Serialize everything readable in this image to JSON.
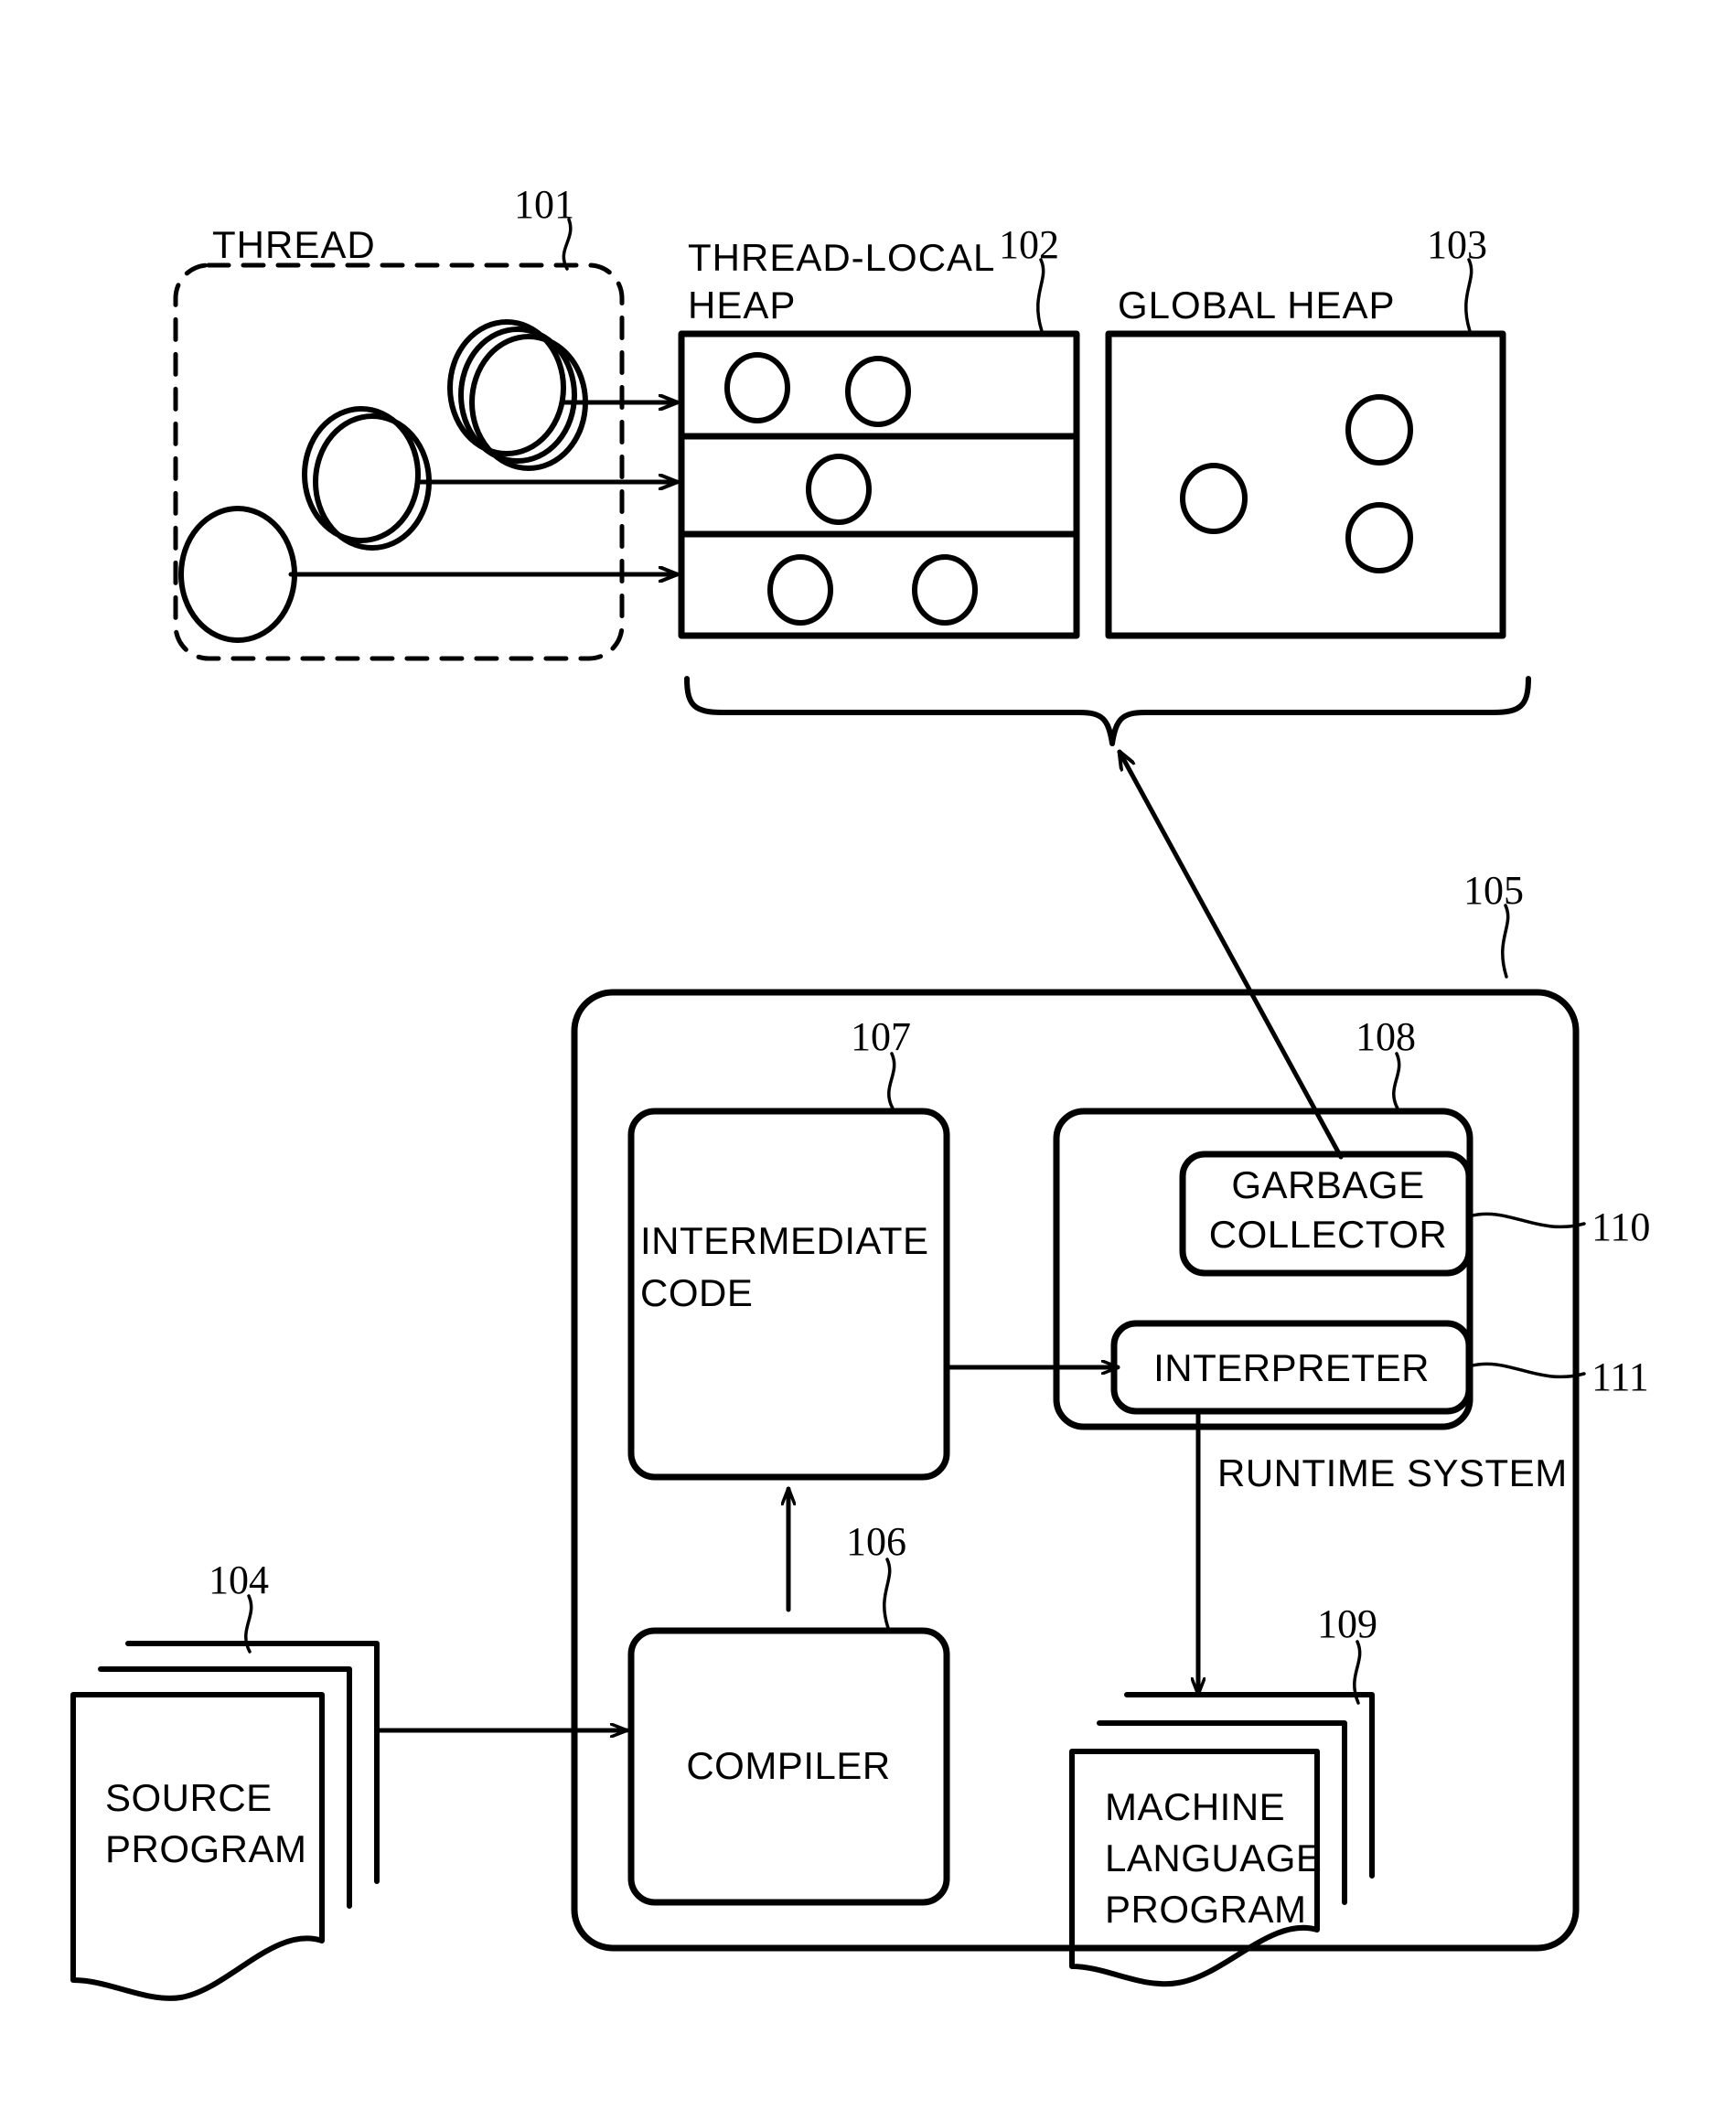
{
  "figure": {
    "title": "Thread-local heap and runtime system block diagram",
    "type": "patent-block-diagram",
    "background_color": "#ffffff",
    "line_color": "#000000"
  },
  "labels": {
    "thread": "THREAD",
    "thread_local_heap_line1": "THREAD-LOCAL",
    "thread_local_heap_line2": "HEAP",
    "global_heap": "GLOBAL HEAP",
    "intermediate_code_line1": "INTERMEDIATE",
    "intermediate_code_line2": "CODE",
    "garbage_collector_line1": "GARBAGE",
    "garbage_collector_line2": "COLLECTOR",
    "interpreter": "INTERPRETER",
    "runtime_system": "RUNTIME SYSTEM",
    "compiler": "COMPILER",
    "source_program_line1": "SOURCE",
    "source_program_line2": "PROGRAM",
    "machine_language_program_line1": "MACHINE",
    "machine_language_program_line2": "LANGUAGE",
    "machine_language_program_line3": "PROGRAM"
  },
  "reference_numerals": {
    "thread": "101",
    "thread_local_heap": "102",
    "global_heap": "103",
    "source_program": "104",
    "system_box": "105",
    "compiler": "106",
    "intermediate_code": "107",
    "runtime_inner_box": "108",
    "machine_language_program": "109",
    "garbage_collector": "110",
    "interpreter": "111"
  },
  "diagram_structure": {
    "thread_box": {
      "border": "dashed",
      "circle_stacks": [
        {
          "position": "top",
          "count": 3
        },
        {
          "position": "middle",
          "count": 2
        },
        {
          "position": "bottom",
          "count": 1
        }
      ],
      "arrows_out": 3
    },
    "thread_local_heap": {
      "rows": 3,
      "objects_per_row": [
        2,
        1,
        2
      ]
    },
    "global_heap": {
      "objects": 3
    },
    "brace": {
      "spans": [
        "thread_local_heap",
        "global_heap"
      ],
      "points_to": "garbage_collector"
    },
    "flows": [
      {
        "from": "source_program",
        "to": "compiler"
      },
      {
        "from": "compiler",
        "to": "intermediate_code"
      },
      {
        "from": "intermediate_code",
        "to": "interpreter"
      },
      {
        "from": "interpreter",
        "to": "machine_language_program"
      },
      {
        "from": "garbage_collector",
        "to": "heaps_brace"
      }
    ]
  }
}
